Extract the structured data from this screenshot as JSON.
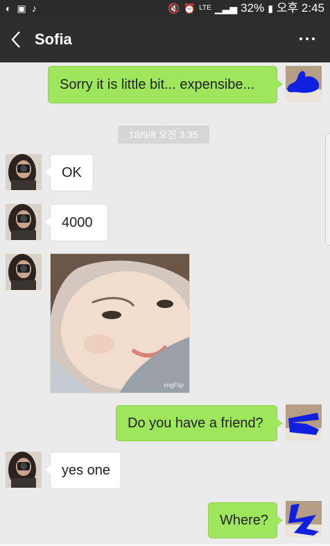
{
  "status_bar": {
    "network": "LTE",
    "battery": "32%",
    "time": "오후 2:45"
  },
  "header": {
    "title": "Sofia"
  },
  "timestamp": "18/9/8 오전 3:35",
  "messages": [
    {
      "side": "right",
      "text": "Sorry it is little bit... expensibe..."
    },
    {
      "side": "left",
      "text": "OK"
    },
    {
      "side": "left",
      "text": "4000"
    },
    {
      "side": "left",
      "type": "image",
      "watermark": "imgFlip"
    },
    {
      "side": "right",
      "text": "Do you have a friend?"
    },
    {
      "side": "left",
      "text": "yes one"
    },
    {
      "side": "right",
      "text": "Where?"
    }
  ],
  "colors": {
    "sent_bubble": "#9ee65c",
    "received_bubble": "#ffffff",
    "header_bg": "#2e2e2e",
    "chat_bg": "#ebebeb",
    "scribble": "#1020e0"
  }
}
